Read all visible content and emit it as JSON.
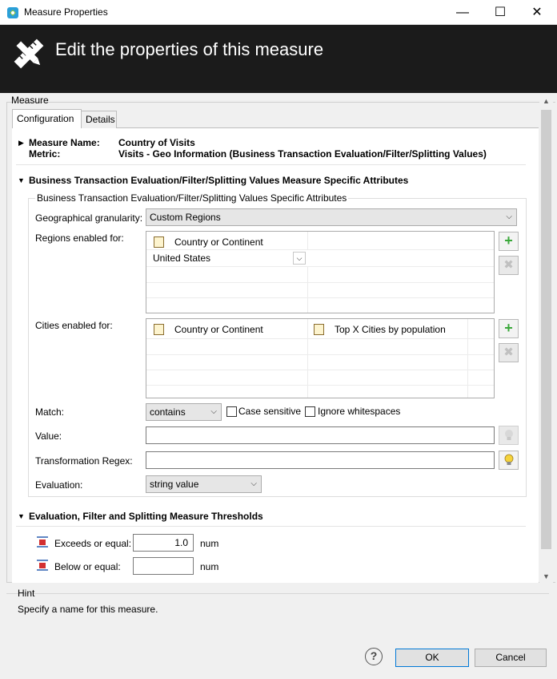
{
  "window": {
    "title": "Measure Properties",
    "minimize": "—",
    "maximize": "☐",
    "close": "✕"
  },
  "banner": {
    "title": "Edit the properties of this measure"
  },
  "measure": {
    "label": "Measure"
  },
  "tabs": [
    {
      "label": "Configuration"
    },
    {
      "label": "Details"
    }
  ],
  "summary": {
    "name_label": "Measure Name:",
    "name_value": "Country of Visits",
    "metric_label": "Metric:",
    "metric_value": "Visits - Geo Information (Business Transaction Evaluation/Filter/Splitting Values)"
  },
  "section_attributes": {
    "title": "Business Transaction Evaluation/Filter/Splitting Values Measure Specific Attributes",
    "group_title": "Business Transaction Evaluation/Filter/Splitting Values Specific Attributes",
    "granularity_label": "Geographical granularity:",
    "granularity_value": "Custom Regions",
    "regions_label": "Regions enabled for:",
    "regions_header": "Country or Continent",
    "regions_row_value": "United States",
    "cities_label": "Cities enabled for:",
    "cities_header_1": "Country or Continent",
    "cities_header_2": "Top X Cities by population",
    "match_label": "Match:",
    "match_value": "contains",
    "case_sensitive_label": "Case sensitive",
    "ignore_ws_label": "Ignore whitespaces",
    "value_label": "Value:",
    "value_value": "",
    "regex_label": "Transformation Regex:",
    "regex_value": "",
    "evaluation_label": "Evaluation:",
    "evaluation_value": "string value"
  },
  "section_thresholds": {
    "title": "Evaluation, Filter and Splitting Measure Thresholds",
    "exceeds_label": "Exceeds or equal:",
    "exceeds_value": "1.0",
    "exceeds_unit": "num",
    "below_label": "Below or equal:",
    "below_value": "",
    "below_unit": "num"
  },
  "hint": {
    "label": "Hint",
    "text": "Specify a name for this measure."
  },
  "footer": {
    "help": "?",
    "ok": "OK",
    "cancel": "Cancel"
  },
  "colors": {
    "banner_bg": "#1b1b1b",
    "add_green": "#3aa83a",
    "ok_border": "#0078d7"
  }
}
